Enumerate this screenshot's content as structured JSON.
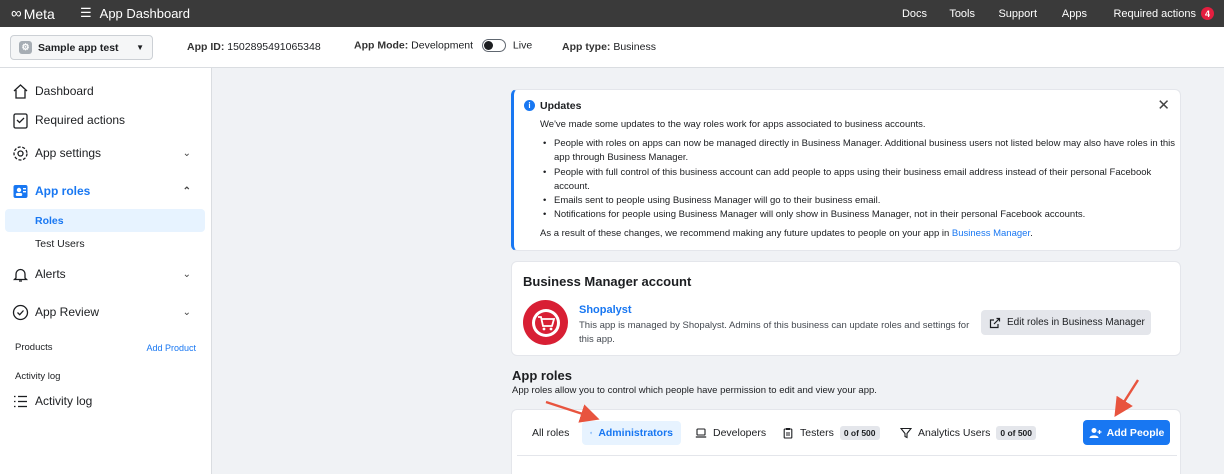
{
  "topbar": {
    "brand": "Meta",
    "title": "App Dashboard",
    "nav": [
      "Docs",
      "Tools",
      "Support",
      "Apps",
      "Required actions"
    ],
    "required_count": "4"
  },
  "appbar": {
    "app_name": "Sample app test",
    "app_id_label": "App ID:",
    "app_id": "1502895491065348",
    "mode_label": "App Mode:",
    "mode_value": "Development",
    "live_label": "Live",
    "type_label": "App type:",
    "type_value": "Business"
  },
  "sidebar": {
    "items": [
      {
        "label": "Dashboard",
        "icon": "home-icon"
      },
      {
        "label": "Required actions",
        "icon": "checklist-icon"
      },
      {
        "label": "App settings",
        "icon": "gear-icon"
      },
      {
        "label": "App roles",
        "icon": "roles-icon"
      },
      {
        "label": "Alerts",
        "icon": "bell-icon"
      },
      {
        "label": "App Review",
        "icon": "shield-check-icon"
      },
      {
        "label": "Activity log",
        "icon": "list-icon"
      }
    ],
    "sub_items": [
      "Roles",
      "Test Users"
    ],
    "products_label": "Products",
    "add_product": "Add Product",
    "activity_section": "Activity log"
  },
  "updates": {
    "title": "Updates",
    "intro": "We've made some updates to the way roles work for apps associated to business accounts.",
    "bullets": [
      "People with roles on apps can now be managed directly in Business Manager. Additional business users not listed below may also have roles in this app through Business Manager.",
      "People with full control of this business account can add people to apps using their business email address instead of their personal Facebook account.",
      "Emails sent to people using Business Manager will go to their business email.",
      "Notifications for people using Business Manager will only show in Business Manager, not in their personal Facebook accounts."
    ],
    "outro": "As a result of these changes, we recommend making any future updates to people on your app in",
    "outro_link": "Business Manager",
    "outro_end": "."
  },
  "business_manager": {
    "heading": "Business Manager account",
    "name": "Shopalyst",
    "description": "This app is managed by Shopalyst. Admins of this business can update roles and settings for this app.",
    "edit_button": "Edit roles in Business Manager"
  },
  "app_roles": {
    "heading": "App roles",
    "description": "App roles allow you to control which people have permission to edit and view your app.",
    "tabs": [
      {
        "label": "All roles"
      },
      {
        "label": "Administrators"
      },
      {
        "label": "Developers"
      },
      {
        "label": "Testers",
        "count": "0 of 500"
      },
      {
        "label": "Analytics Users",
        "count": "0 of 500"
      }
    ],
    "add_button": "Add People"
  },
  "colors": {
    "accent": "#1877f2",
    "annotation_arrow": "#e8543e",
    "topbar": "#3a3a3a",
    "brand_logo": "#d81f34"
  }
}
